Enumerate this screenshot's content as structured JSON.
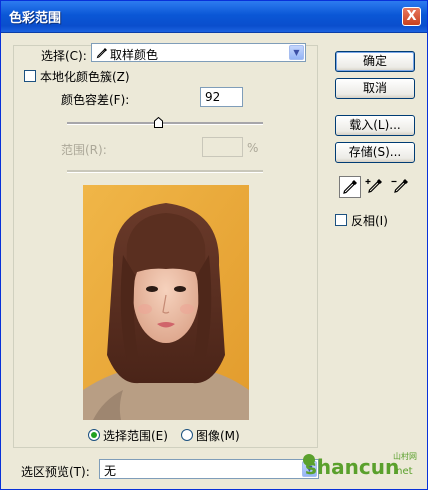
{
  "window": {
    "title": "色彩范围",
    "close_glyph": "X"
  },
  "select": {
    "label": "选择(C):",
    "value": "取样颜色"
  },
  "localized": {
    "label": "本地化颜色簇(Z)",
    "checked": false
  },
  "fuzziness": {
    "label": "颜色容差(F):",
    "value": "92",
    "fraction": 0.46
  },
  "range": {
    "label": "范围(R):",
    "value": "",
    "unit": "%",
    "enabled": false
  },
  "preview_mode": {
    "selection_label": "选择范围(E)",
    "image_label": "图像(M)",
    "selected": "selection"
  },
  "selection_preview": {
    "label": "选区预览(T):",
    "value": "无"
  },
  "buttons": {
    "ok": "确定",
    "cancel": "取消",
    "load": "载入(L)...",
    "save": "存储(S)..."
  },
  "tools": [
    "eyedropper-icon",
    "eyedropper-plus-icon",
    "eyedropper-minus-icon"
  ],
  "invert": {
    "label": "反相(I)",
    "checked": false
  },
  "watermark": {
    "text": "shancun",
    "suffix": ".net",
    "cn": "山村网"
  },
  "colors": {
    "title_bar": "#0a57d6",
    "dialog_bg": "#ece9d8",
    "photo_bg": "#e9a83a",
    "radio_dot": "#21a121",
    "watermark_green": "#5aa02c"
  }
}
